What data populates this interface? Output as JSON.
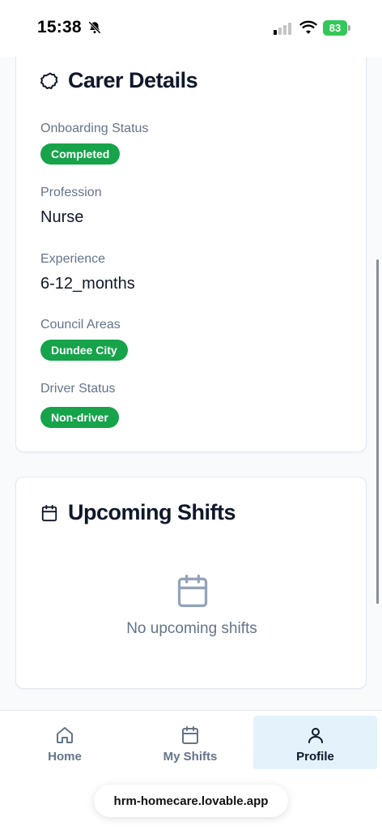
{
  "status_bar": {
    "time": "15:38",
    "battery": "83"
  },
  "carer_details": {
    "title": "Carer Details",
    "icon": "badge-icon",
    "fields": [
      {
        "label": "Onboarding Status",
        "value": "Completed",
        "kind": "badge"
      },
      {
        "label": "Profession",
        "value": "Nurse",
        "kind": "text"
      },
      {
        "label": "Experience",
        "value": "6-12_months",
        "kind": "text"
      },
      {
        "label": "Council Areas",
        "value": "Dundee City",
        "kind": "badge"
      },
      {
        "label": "Driver Status",
        "value": "Non-driver",
        "kind": "badge"
      }
    ]
  },
  "upcoming_shifts": {
    "title": "Upcoming Shifts",
    "icon": "calendar-icon",
    "empty_text": "No upcoming shifts"
  },
  "nav": {
    "items": [
      {
        "label": "Home",
        "icon": "home-icon",
        "active": false
      },
      {
        "label": "My Shifts",
        "icon": "calendar-icon",
        "active": false
      },
      {
        "label": "Profile",
        "icon": "user-icon",
        "active": true
      }
    ]
  },
  "browser": {
    "url": "hrm-homecare.lovable.app"
  },
  "colors": {
    "badge_green": "#16a34a",
    "active_nav_bg": "#e3f2fb",
    "muted_text": "#64748b"
  }
}
